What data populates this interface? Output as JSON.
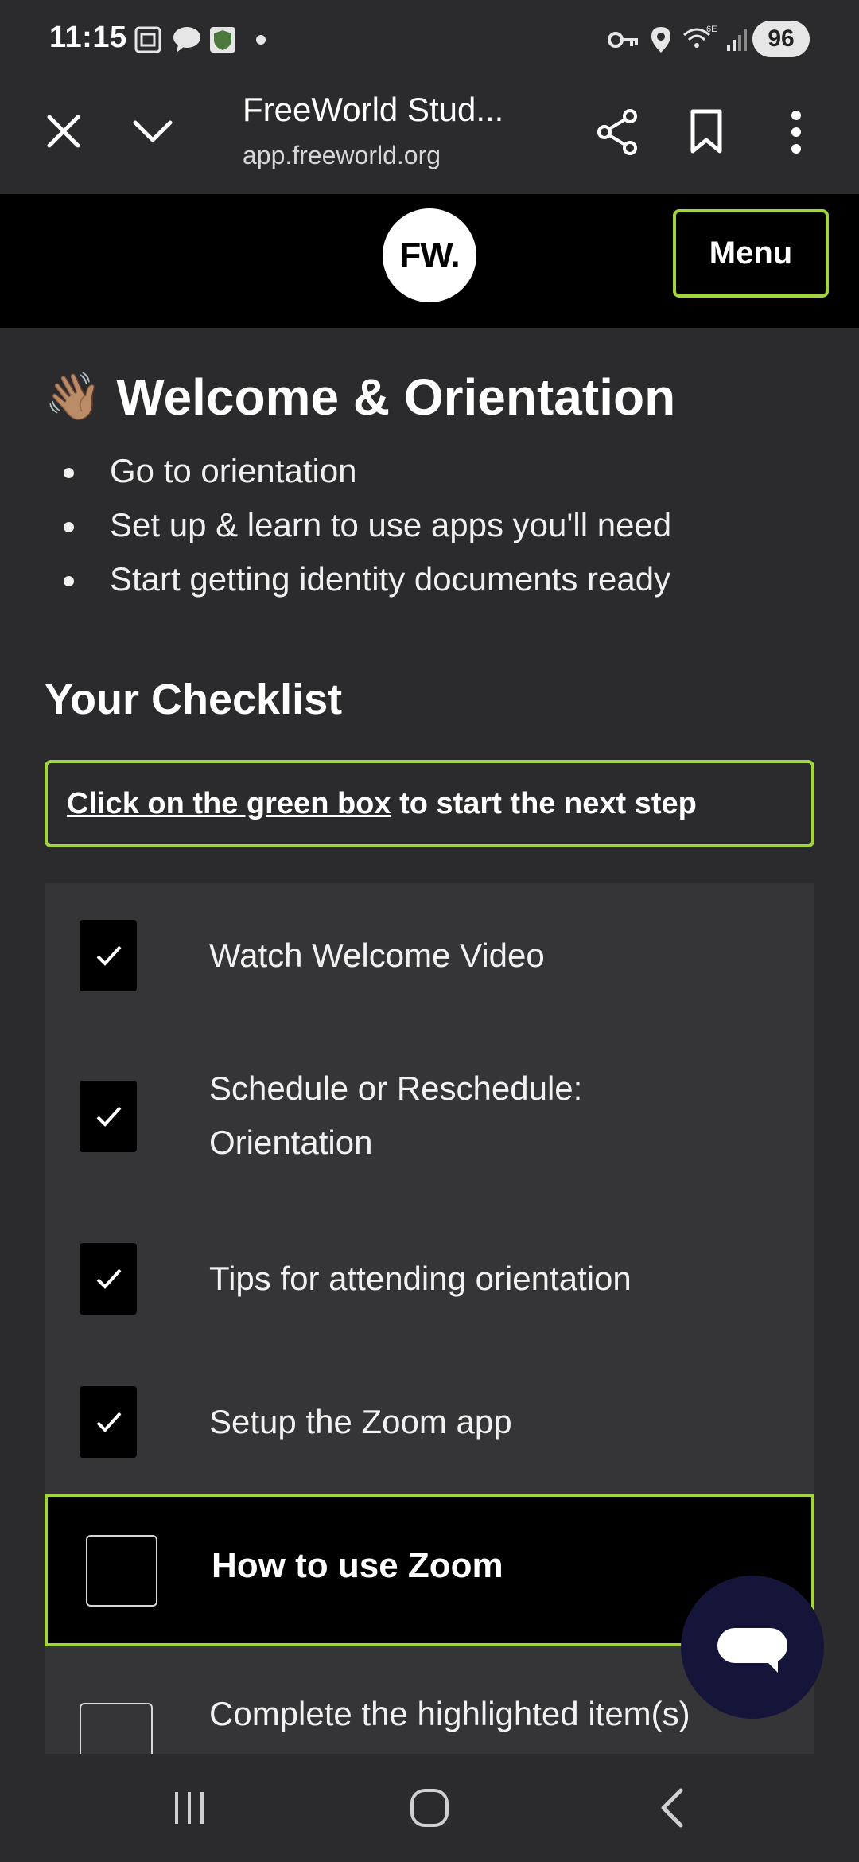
{
  "status_bar": {
    "time": "11:15",
    "battery": "96",
    "icons": [
      "screenshot-icon",
      "chat-notification-icon",
      "shield-app-icon",
      "dot-icon",
      "vpn-key-icon",
      "location-icon",
      "wifi-6e-icon",
      "signal-icon"
    ]
  },
  "browser": {
    "title": "FreeWorld Stud...",
    "url": "app.freeworld.org",
    "icons": [
      "close-icon",
      "chevron-down-icon",
      "share-icon",
      "bookmark-icon",
      "more-vert-icon"
    ]
  },
  "site_header": {
    "logo_text": "FW.",
    "menu_label": "Menu",
    "accent_color": "#a2d43c"
  },
  "welcome": {
    "emoji": "👋🏽",
    "title": "Welcome & Orientation",
    "bullets": [
      "Go to orientation",
      "Set up & learn to use apps you'll need",
      "Start getting identity documents ready"
    ]
  },
  "checklist": {
    "title": "Your Checklist",
    "hint_link": "Click on the green box",
    "hint_rest": " to start the next step",
    "items": [
      {
        "label": "Watch Welcome Video",
        "checked": true
      },
      {
        "label": "Schedule or Reschedule: Orientation",
        "line1": "Schedule or Reschedule:",
        "line2": "Orientation",
        "checked": true
      },
      {
        "label": "Tips for attending orientation",
        "checked": true
      },
      {
        "label": "Setup the Zoom app",
        "checked": true
      },
      {
        "label": "How to use Zoom",
        "checked": false,
        "highlighted": true
      },
      {
        "label": "Complete the highlighted item(s)",
        "checked": false
      }
    ]
  },
  "chat_button": {
    "icon": "chat-bubble-icon"
  },
  "nav_bar": {
    "icons": [
      "recent-apps-icon",
      "home-icon",
      "back-icon"
    ]
  }
}
